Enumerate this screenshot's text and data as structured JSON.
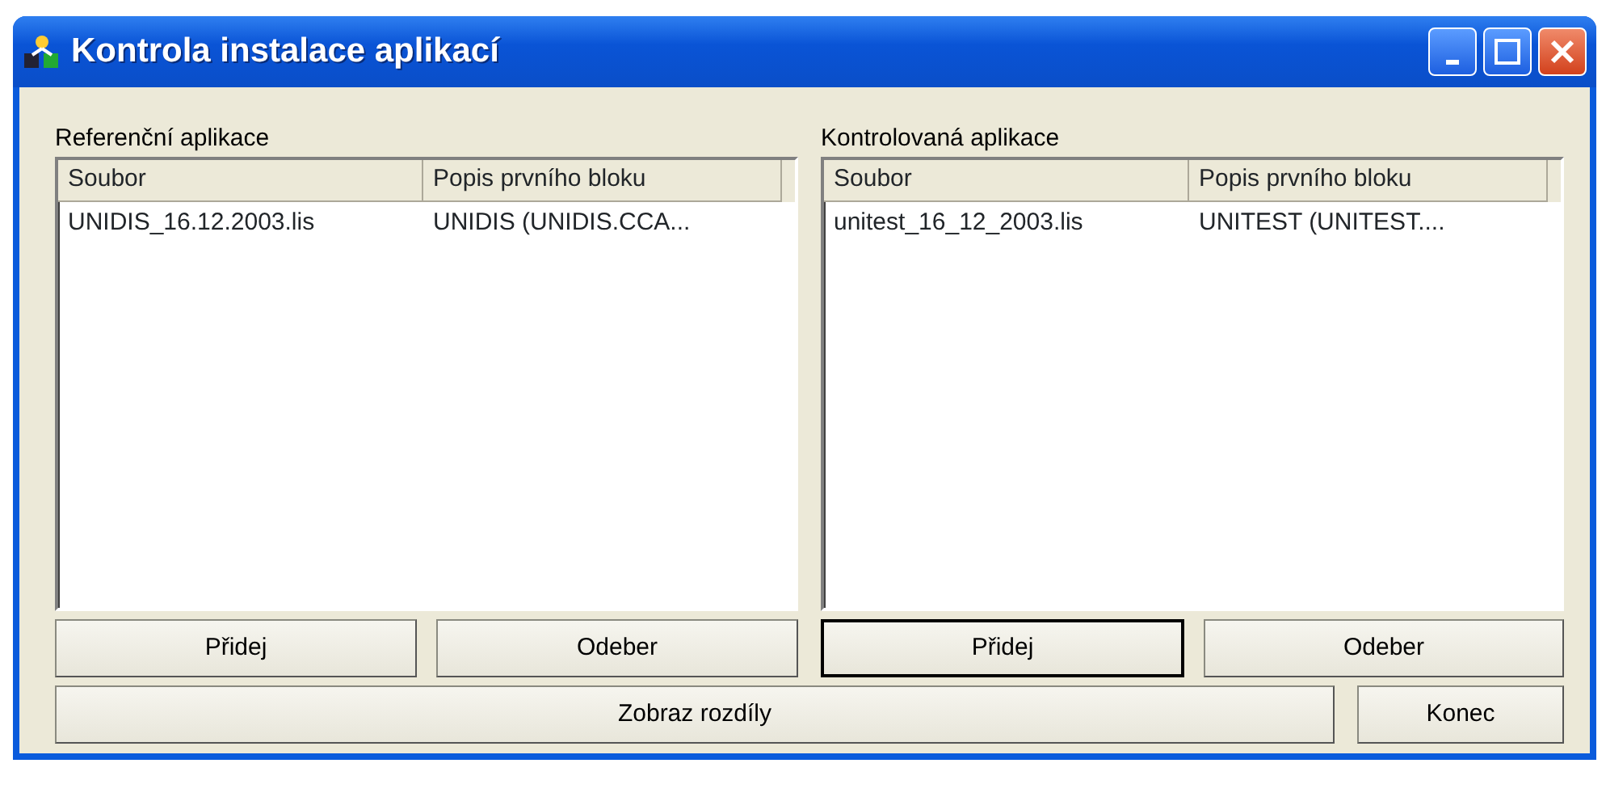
{
  "window": {
    "title": "Kontrola instalace aplikací"
  },
  "panels": [
    {
      "label": "Referenční aplikace",
      "columns": [
        "Soubor",
        "Popis prvního bloku"
      ],
      "rows": [
        [
          "UNIDIS_16.12.2003.lis",
          "UNIDIS (UNIDIS.CCA..."
        ]
      ],
      "buttons": [
        {
          "label": "Přidej",
          "focused": false
        },
        {
          "label": "Odeber",
          "focused": false
        }
      ]
    },
    {
      "label": "Kontrolovaná aplikace",
      "columns": [
        "Soubor",
        "Popis prvního bloku"
      ],
      "rows": [
        [
          "unitest_16_12_2003.lis",
          "UNITEST (UNITEST...."
        ]
      ],
      "buttons": [
        {
          "label": "Přidej",
          "focused": true
        },
        {
          "label": "Odeber",
          "focused": false
        }
      ]
    }
  ],
  "bottom_buttons": [
    {
      "label": "Zobraz rozdíly",
      "focused": false
    },
    {
      "label": "Konec",
      "focused": false
    }
  ]
}
